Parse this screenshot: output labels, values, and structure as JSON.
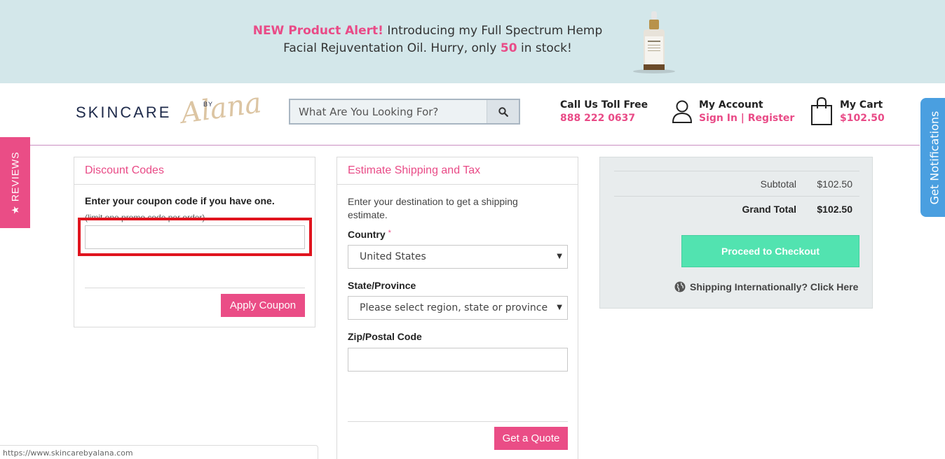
{
  "promo": {
    "highlight": "NEW Product Alert!",
    "text_line1": "Introducing my Full Spectrum Hemp",
    "text_line2_pre": "Facial Rejuventation Oil. Hurry, only",
    "stock_count": "50",
    "text_line2_post": "in stock!"
  },
  "logo": {
    "main": "SKINCARE",
    "by": "BY",
    "script": "Alana"
  },
  "search": {
    "placeholder": "What Are You Looking For?",
    "icon": "search-icon"
  },
  "header": {
    "call_title": "Call Us Toll Free",
    "call_number": "888 222 0637",
    "account_title": "My Account",
    "account_links": "Sign In | Register",
    "cart_title": "My Cart",
    "cart_total": "$102.50"
  },
  "side_tabs": {
    "reviews": "★ REVIEWS",
    "notifications": "Get Notifications"
  },
  "discount": {
    "title": "Discount Codes",
    "label": "Enter your coupon code if you have one.",
    "sublabel": "(limit one promo code per order)",
    "button": "Apply Coupon"
  },
  "shipping": {
    "title": "Estimate Shipping and Tax",
    "intro": "Enter your destination to get a shipping estimate.",
    "country_label": "Country",
    "required_mark": "*",
    "country_value": "United States",
    "state_label": "State/Province",
    "state_value": "Please select region, state or province",
    "zip_label": "Zip/Postal Code",
    "button": "Get a Quote"
  },
  "summary": {
    "subtotal_label": "Subtotal",
    "subtotal_value": "$102.50",
    "grand_total_label": "Grand Total",
    "grand_total_value": "$102.50",
    "checkout_button": "Proceed to Checkout",
    "international_link": "Shipping Internationally? Click Here"
  },
  "status_bar": {
    "url": "https://www.skincarebyalana.com"
  },
  "colors": {
    "accent_pink": "#e94b87",
    "banner_bg": "#d3e7ea",
    "checkout_green": "#52e3b0",
    "notif_blue": "#4a9fe0",
    "highlight_red": "#e0141e"
  }
}
